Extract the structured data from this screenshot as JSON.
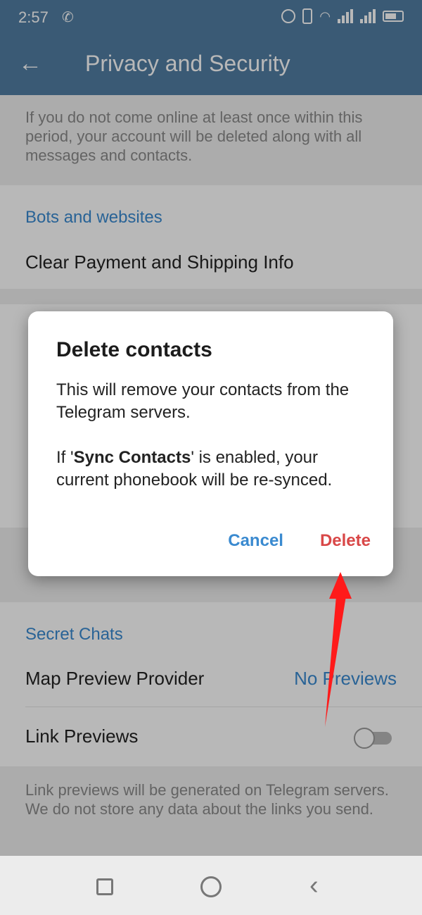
{
  "status_bar": {
    "time": "2:57",
    "left_icon": "call-forward-icon",
    "right_icons": [
      "alarm-icon",
      "vibrate-icon",
      "wifi-icon",
      "signal-icon",
      "signal-icon",
      "battery-icon"
    ]
  },
  "header": {
    "back_icon": "arrow-left-icon",
    "title": "Privacy and Security"
  },
  "content": {
    "delete_info": "If you do not come online at least once within this period, your account will be deleted along with all messages and contacts.",
    "bots_section": "Bots and websites",
    "clear_payment": "Clear Payment and Shipping Info",
    "secret_section": "Secret Chats",
    "map_preview_label": "Map Preview Provider",
    "map_preview_value": "No Previews",
    "link_previews_label": "Link Previews",
    "link_previews_info": "Link previews will be generated on Telegram servers. We do not store any data about the links you send."
  },
  "dialog": {
    "title": "Delete contacts",
    "body_1": "This will remove your contacts from the Telegram servers.",
    "body_2_prefix": "If '",
    "body_2_bold": "Sync Contacts",
    "body_2_suffix": "' is enabled, your current phonebook will be re-synced.",
    "cancel_label": "Cancel",
    "delete_label": "Delete"
  },
  "colors": {
    "header_bg": "#517da2",
    "accent": "#3a8ad0",
    "danger": "#d94848",
    "annotation_arrow": "#ff1a1a"
  },
  "nav_bar": {
    "icons": [
      "recents-square-icon",
      "home-circle-icon",
      "back-chevron-icon"
    ]
  }
}
